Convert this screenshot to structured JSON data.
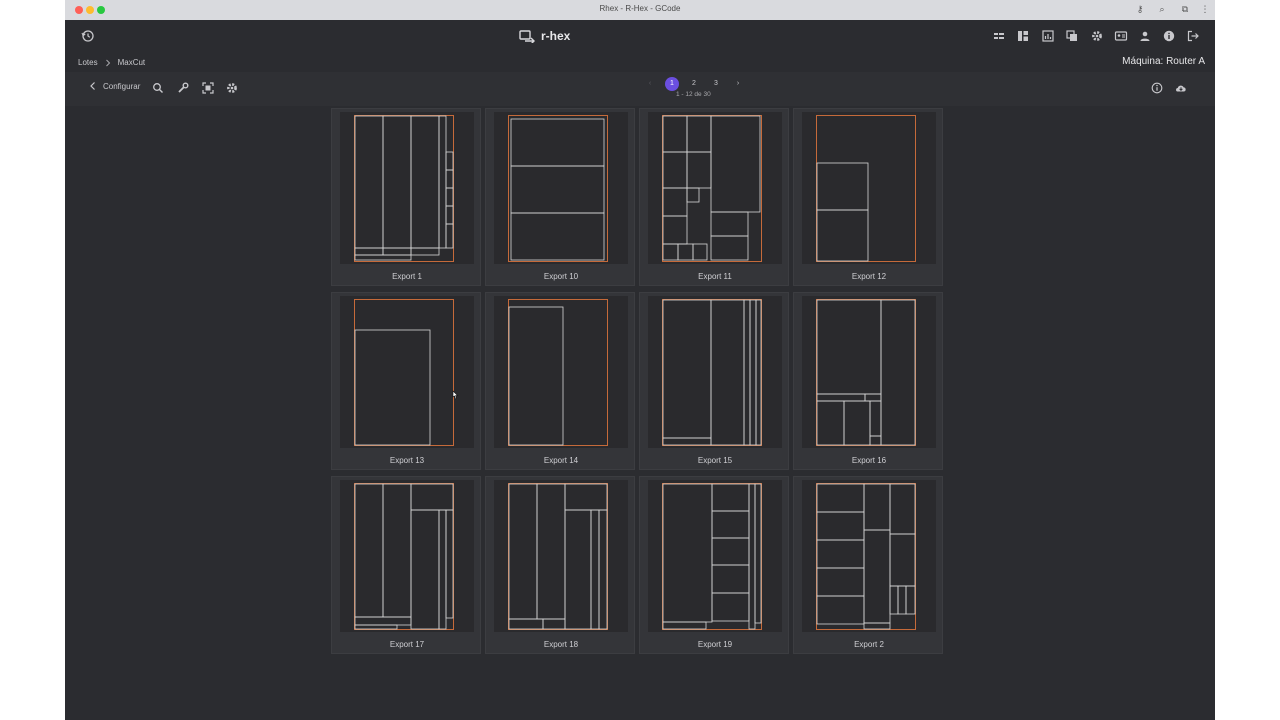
{
  "window": {
    "title": "Rhex - R-Hex - GCode"
  },
  "app": {
    "brand": "r-hex"
  },
  "breadcrumbs": [
    "Lotes",
    "MaxCut"
  ],
  "machine": "Máquina: Router A",
  "toolbar": {
    "back_label": "Configurar"
  },
  "pagination": {
    "pages": [
      "1",
      "2",
      "3"
    ],
    "current": "1",
    "range": "1 - 12 de 30"
  },
  "colors": {
    "accent": "#6b4fe0",
    "sheet": "#c56a3a",
    "cut": "#d8d8d8",
    "background": "#2b2c30"
  },
  "exports": [
    {
      "name": "Export 1"
    },
    {
      "name": "Export 10"
    },
    {
      "name": "Export 11"
    },
    {
      "name": "Export 12"
    },
    {
      "name": "Export 13"
    },
    {
      "name": "Export 14"
    },
    {
      "name": "Export 15"
    },
    {
      "name": "Export 16"
    },
    {
      "name": "Export 17"
    },
    {
      "name": "Export 18"
    },
    {
      "name": "Export 19"
    },
    {
      "name": "Export 2"
    }
  ]
}
